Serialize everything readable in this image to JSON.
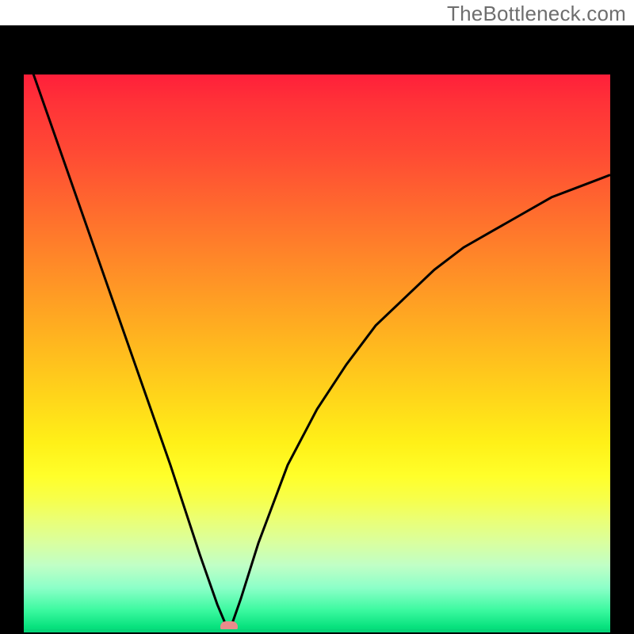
{
  "watermark": "TheBottleneck.com",
  "colors": {
    "frame": "#000000",
    "curve": "#000000",
    "marker": "#e98b8b",
    "gradient_top": "#ff1f3a",
    "gradient_bottom": "#06d578"
  },
  "chart_data": {
    "type": "line",
    "title": "",
    "xlabel": "",
    "ylabel": "",
    "xlim": [
      0,
      100
    ],
    "ylim": [
      0,
      100
    ],
    "vertex_x": 35,
    "marker": {
      "x": 35,
      "width_pct": 3.0
    },
    "x": [
      0,
      5,
      10,
      15,
      20,
      25,
      30,
      33,
      35,
      37,
      40,
      45,
      50,
      55,
      60,
      65,
      70,
      75,
      80,
      85,
      90,
      95,
      100
    ],
    "y": [
      105,
      90,
      75,
      60,
      45,
      30,
      14,
      5,
      0,
      6,
      16,
      30,
      40,
      48,
      55,
      60,
      65,
      69,
      72,
      75,
      78,
      80,
      82
    ],
    "note": "y is plotted downward from top; x/y are in percent of plot area; values estimated from pixels"
  }
}
